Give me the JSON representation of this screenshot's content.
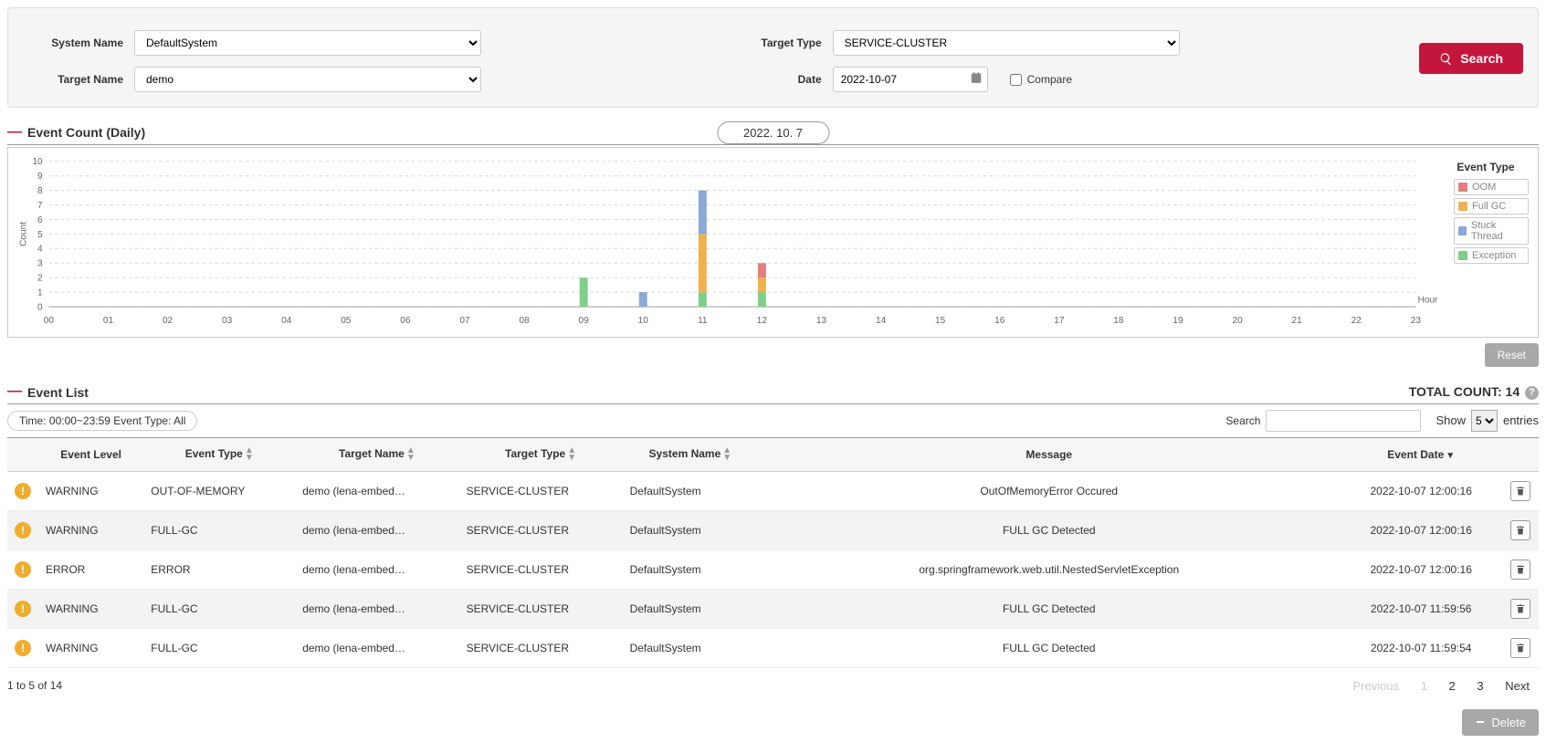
{
  "filters": {
    "system_name_label": "System Name",
    "system_name_value": "DefaultSystem",
    "target_type_label": "Target Type",
    "target_type_value": "SERVICE-CLUSTER",
    "target_name_label": "Target Name",
    "target_name_value": "demo",
    "date_label": "Date",
    "date_value": "2022-10-07",
    "compare_label": "Compare",
    "search_button": "Search"
  },
  "chart_section": {
    "title": "Event Count (Daily)",
    "date_pill": "2022. 10. 7",
    "legend_title": "Event Type",
    "legend": {
      "oom": "OOM",
      "fullgc": "Full GC",
      "stuck": "Stuck Thread",
      "exception": "Exception"
    },
    "xaxis_label": "Hour",
    "yaxis_label": "Count",
    "reset_button": "Reset"
  },
  "chart_data": {
    "type": "bar",
    "categories": [
      "00",
      "01",
      "02",
      "03",
      "04",
      "05",
      "06",
      "07",
      "08",
      "09",
      "10",
      "11",
      "12",
      "13",
      "14",
      "15",
      "16",
      "17",
      "18",
      "19",
      "20",
      "21",
      "22",
      "23"
    ],
    "ylim": [
      0,
      10
    ],
    "xlabel": "Hour",
    "ylabel": "Count",
    "series": [
      {
        "name": "OOM",
        "color": "#e67e7e",
        "values": [
          0,
          0,
          0,
          0,
          0,
          0,
          0,
          0,
          0,
          0,
          0,
          0,
          1,
          0,
          0,
          0,
          0,
          0,
          0,
          0,
          0,
          0,
          0,
          0
        ]
      },
      {
        "name": "Full GC",
        "color": "#f0b24e",
        "values": [
          0,
          0,
          0,
          0,
          0,
          0,
          0,
          0,
          0,
          0,
          0,
          4,
          1,
          0,
          0,
          0,
          0,
          0,
          0,
          0,
          0,
          0,
          0,
          0
        ]
      },
      {
        "name": "Stuck Thread",
        "color": "#8aa9d6",
        "values": [
          0,
          0,
          0,
          0,
          0,
          0,
          0,
          0,
          0,
          0,
          1,
          3,
          0,
          0,
          0,
          0,
          0,
          0,
          0,
          0,
          0,
          0,
          0,
          0
        ]
      },
      {
        "name": "Exception",
        "color": "#7fcf8a",
        "values": [
          0,
          0,
          0,
          0,
          0,
          0,
          0,
          0,
          0,
          2,
          0,
          1,
          1,
          0,
          0,
          0,
          0,
          0,
          0,
          0,
          0,
          0,
          0,
          0
        ]
      }
    ]
  },
  "list_section": {
    "title": "Event List",
    "total_count_label": "TOTAL COUNT:",
    "total_count_value": "14",
    "filter_pill": "Time: 00:00~23:59 Event Type: All",
    "search_label": "Search",
    "show_label": "Show",
    "show_value": "5",
    "entries_label": "entries",
    "columns": {
      "level": "Event Level",
      "type": "Event Type",
      "target_name": "Target Name",
      "target_type": "Target Type",
      "system_name": "System Name",
      "message": "Message",
      "date": "Event Date"
    },
    "rows": [
      {
        "level": "WARNING",
        "type": "OUT-OF-MEMORY",
        "target": "demo (lena-embed…",
        "ttype": "SERVICE-CLUSTER",
        "sys": "DefaultSystem",
        "msg": "OutOfMemoryError Occured",
        "date": "2022-10-07 12:00:16"
      },
      {
        "level": "WARNING",
        "type": "FULL-GC",
        "target": "demo (lena-embed…",
        "ttype": "SERVICE-CLUSTER",
        "sys": "DefaultSystem",
        "msg": "FULL GC Detected",
        "date": "2022-10-07 12:00:16"
      },
      {
        "level": "ERROR",
        "type": "ERROR",
        "target": "demo (lena-embed…",
        "ttype": "SERVICE-CLUSTER",
        "sys": "DefaultSystem",
        "msg": "org.springframework.web.util.NestedServletException",
        "date": "2022-10-07 12:00:16"
      },
      {
        "level": "WARNING",
        "type": "FULL-GC",
        "target": "demo (lena-embed…",
        "ttype": "SERVICE-CLUSTER",
        "sys": "DefaultSystem",
        "msg": "FULL GC Detected",
        "date": "2022-10-07 11:59:56"
      },
      {
        "level": "WARNING",
        "type": "FULL-GC",
        "target": "demo (lena-embed…",
        "ttype": "SERVICE-CLUSTER",
        "sys": "DefaultSystem",
        "msg": "FULL GC Detected",
        "date": "2022-10-07 11:59:54"
      }
    ],
    "pager_info": "1 to 5 of 14",
    "pager": {
      "prev": "Previous",
      "p1": "1",
      "p2": "2",
      "p3": "3",
      "next": "Next"
    },
    "delete_button": "Delete"
  }
}
